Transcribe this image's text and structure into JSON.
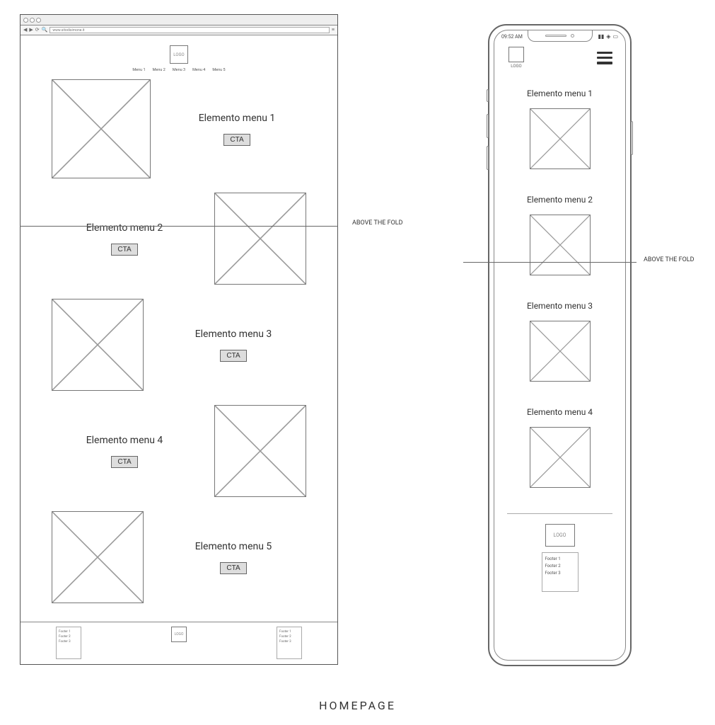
{
  "page_title": "HOMEPAGE",
  "fold_label": "ABOVE THE FOLD",
  "logo_label": "LOGO",
  "browser": {
    "url": "www.sitodisimone.it",
    "nav": [
      "Menu 1",
      "Menu 2",
      "Menu 3",
      "Menu 4",
      "Menu 5"
    ],
    "sections": [
      {
        "title": "Elemento menu 1",
        "cta": "CTA"
      },
      {
        "title": "Elemento menu 2",
        "cta": "CTA"
      },
      {
        "title": "Elemento menu 3",
        "cta": "CTA"
      },
      {
        "title": "Elemento menu 4",
        "cta": "CTA"
      },
      {
        "title": "Elemento menu 5",
        "cta": "CTA"
      }
    ],
    "footer_left": [
      "Footer 1",
      "Footer 2",
      "Footer 3"
    ],
    "footer_right": [
      "Footer 1",
      "Footer 2",
      "Footer 3"
    ]
  },
  "mobile": {
    "time": "09:52 AM",
    "sections": [
      {
        "title": "Elemento menu 1"
      },
      {
        "title": "Elemento menu 2"
      },
      {
        "title": "Elemento menu 3"
      },
      {
        "title": "Elemento menu 4"
      }
    ],
    "footer": [
      "Footer 1",
      "Footer 2",
      "Footer 3"
    ]
  }
}
